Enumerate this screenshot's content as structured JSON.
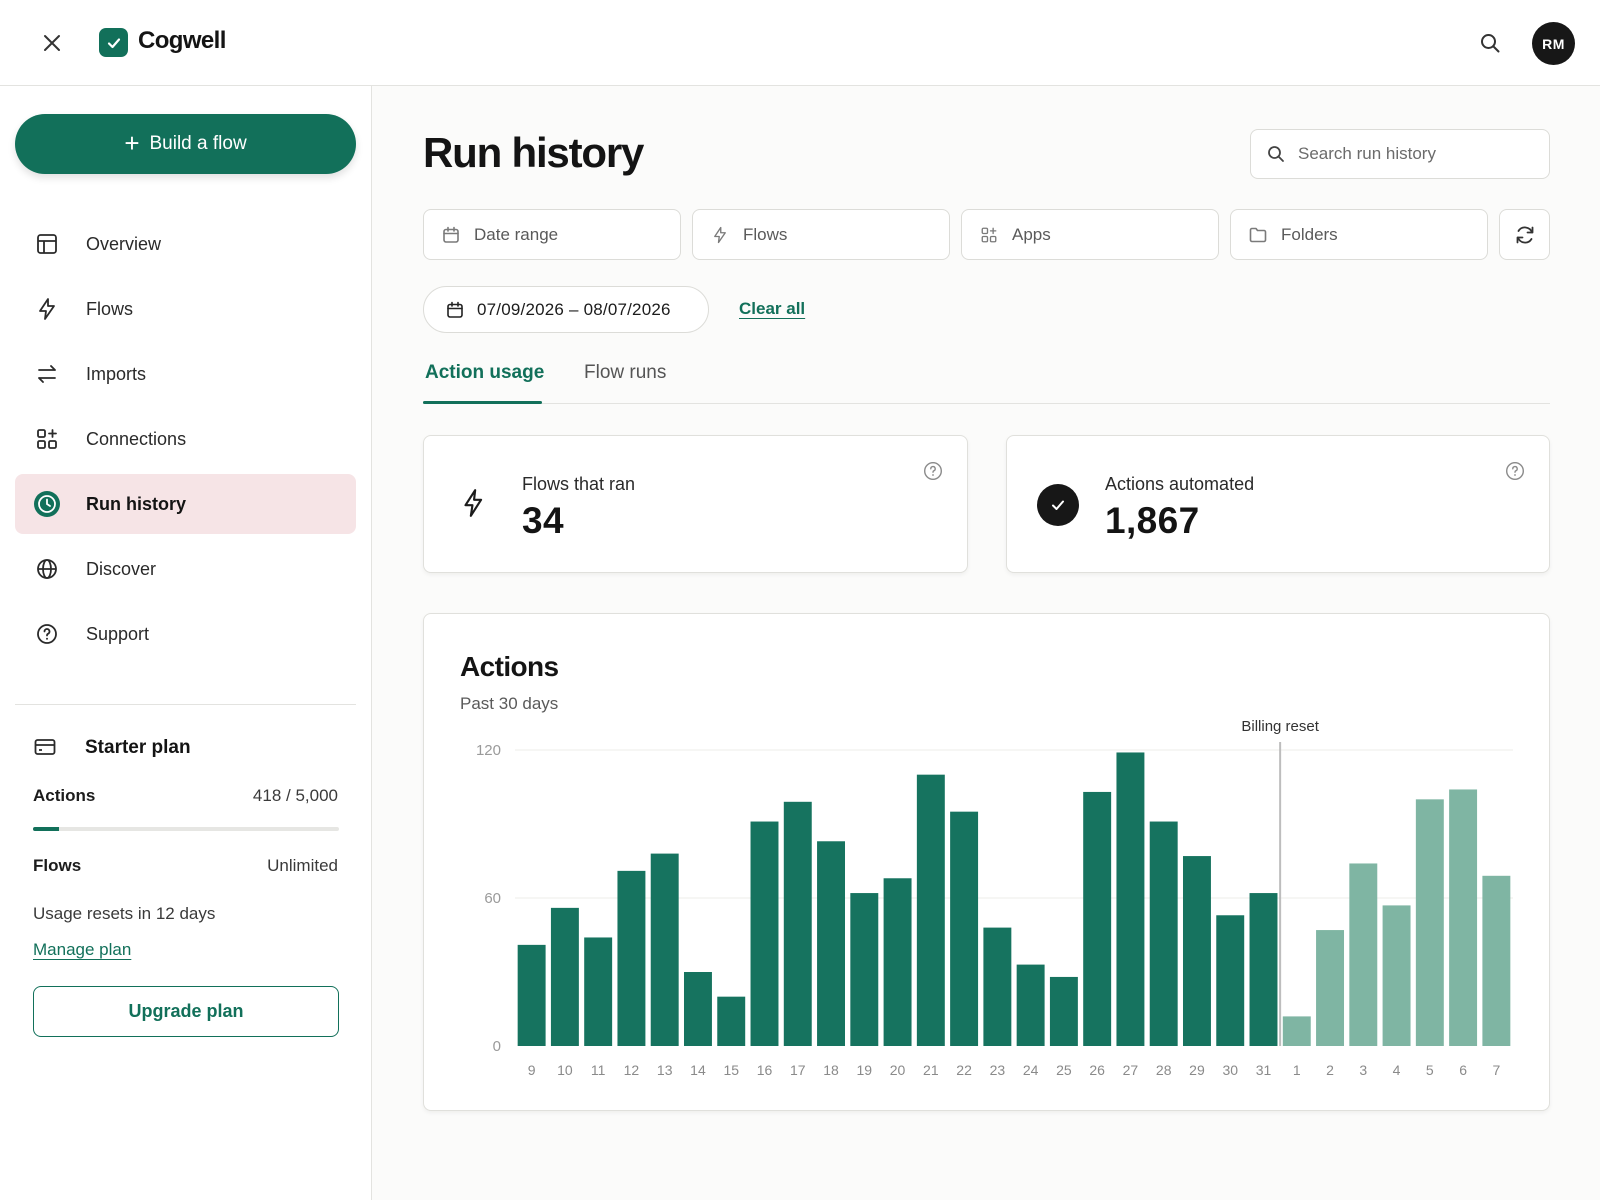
{
  "app": {
    "brand": "Cogwell"
  },
  "topbar": {
    "avatar_initials": "RM"
  },
  "sidebar": {
    "build_label": "Build a flow",
    "items": [
      {
        "label": "Overview",
        "icon": "layout-icon"
      },
      {
        "label": "Flows",
        "icon": "bolt-icon"
      },
      {
        "label": "Imports",
        "icon": "swap-icon"
      },
      {
        "label": "Connections",
        "icon": "grid-plus-icon"
      },
      {
        "label": "Run history",
        "icon": "clock-icon",
        "active": true
      },
      {
        "label": "Discover",
        "icon": "globe-icon"
      },
      {
        "label": "Support",
        "icon": "help-icon"
      }
    ],
    "plan": {
      "title": "Starter plan",
      "actions_label": "Actions",
      "actions_value": "418 / 5,000",
      "actions_used_fraction": 0.0836,
      "flows_label": "Flows",
      "flows_value": "Unlimited",
      "resets_text": "Usage resets in 12 days",
      "manage_label": "Manage plan",
      "upgrade_label": "Upgrade plan"
    }
  },
  "main": {
    "title": "Run history",
    "search_placeholder": "Search run history",
    "filters": [
      {
        "label": "Date range",
        "icon": "calendar-icon"
      },
      {
        "label": "Flows",
        "icon": "bolt-icon"
      },
      {
        "label": "Apps",
        "icon": "apps-icon"
      },
      {
        "label": "Folders",
        "icon": "folder-icon"
      }
    ],
    "active_date": "07/09/2026 – 08/07/2026",
    "clear_all_label": "Clear all",
    "tabs": [
      {
        "label": "Action usage",
        "active": true
      },
      {
        "label": "Flow runs",
        "active": false
      }
    ],
    "stats": {
      "flows_label": "Flows that ran",
      "flows_value": "34",
      "actions_label": "Actions automated",
      "actions_value": "1,867"
    }
  },
  "colors": {
    "accent": "#12705a",
    "bar_past": "#16735f",
    "bar_future": "#7fb5a3",
    "active_nav_bg": "#f6e4e6"
  },
  "chart_data": {
    "type": "bar",
    "title": "Actions",
    "subtitle": "Past 30 days",
    "categories": [
      "9",
      "10",
      "11",
      "12",
      "13",
      "14",
      "15",
      "16",
      "17",
      "18",
      "19",
      "20",
      "21",
      "22",
      "23",
      "24",
      "25",
      "26",
      "27",
      "28",
      "29",
      "30",
      "31",
      "1",
      "2",
      "3",
      "4",
      "5",
      "6",
      "7"
    ],
    "values": [
      41,
      56,
      44,
      71,
      78,
      30,
      20,
      91,
      99,
      83,
      62,
      68,
      110,
      95,
      48,
      33,
      28,
      103,
      119,
      91,
      77,
      53,
      62,
      12,
      47,
      74,
      57,
      100,
      104,
      69
    ],
    "after_reset_start_index": 23,
    "ylim": [
      0,
      120
    ],
    "yticks": [
      0,
      60,
      120
    ],
    "annotation": {
      "label": "Billing reset",
      "between": [
        "31",
        "1"
      ]
    },
    "grid": true,
    "legend": false
  }
}
